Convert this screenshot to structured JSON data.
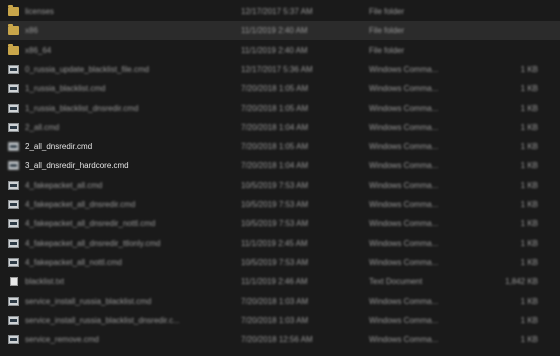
{
  "rows": [
    {
      "name": "licenses",
      "date": "12/17/2017 5:37 AM",
      "type": "File folder",
      "size": "",
      "icon": "folder"
    },
    {
      "name": "x86",
      "date": "11/1/2019 2:40 AM",
      "type": "File folder",
      "size": "",
      "icon": "folder",
      "selected": true
    },
    {
      "name": "x86_64",
      "date": "11/1/2019 2:40 AM",
      "type": "File folder",
      "size": "",
      "icon": "folder"
    },
    {
      "name": "0_russia_update_blacklist_file.cmd",
      "date": "12/17/2017 5:36 AM",
      "type": "Windows Comma...",
      "size": "1 KB",
      "icon": "cmd"
    },
    {
      "name": "1_russia_blacklist.cmd",
      "date": "7/20/2018 1:05 AM",
      "type": "Windows Comma...",
      "size": "1 KB",
      "icon": "cmd"
    },
    {
      "name": "1_russia_blacklist_dnsredir.cmd",
      "date": "7/20/2018 1:05 AM",
      "type": "Windows Comma...",
      "size": "1 KB",
      "icon": "cmd"
    },
    {
      "name": "2_all.cmd",
      "date": "7/20/2018 1:04 AM",
      "type": "Windows Comma...",
      "size": "1 KB",
      "icon": "cmd"
    },
    {
      "name": "2_all_dnsredir.cmd",
      "date": "7/20/2018 1:05 AM",
      "type": "Windows Comma...",
      "size": "1 KB",
      "icon": "cmd",
      "focus": true
    },
    {
      "name": "3_all_dnsredir_hardcore.cmd",
      "date": "7/20/2018 1:04 AM",
      "type": "Windows Comma...",
      "size": "1 KB",
      "icon": "cmd",
      "focus": true
    },
    {
      "name": "4_fakepacket_all.cmd",
      "date": "10/5/2019 7:53 AM",
      "type": "Windows Comma...",
      "size": "1 KB",
      "icon": "cmd"
    },
    {
      "name": "4_fakepacket_all_dnsredir.cmd",
      "date": "10/5/2019 7:53 AM",
      "type": "Windows Comma...",
      "size": "1 KB",
      "icon": "cmd"
    },
    {
      "name": "4_fakepacket_all_dnsredir_nottl.cmd",
      "date": "10/5/2019 7:53 AM",
      "type": "Windows Comma...",
      "size": "1 KB",
      "icon": "cmd"
    },
    {
      "name": "4_fakepacket_all_dnsredir_ttlonly.cmd",
      "date": "11/1/2019 2:45 AM",
      "type": "Windows Comma...",
      "size": "1 KB",
      "icon": "cmd"
    },
    {
      "name": "4_fakepacket_all_nottl.cmd",
      "date": "10/5/2019 7:53 AM",
      "type": "Windows Comma...",
      "size": "1 KB",
      "icon": "cmd"
    },
    {
      "name": "blacklist.txt",
      "date": "11/1/2019 2:46 AM",
      "type": "Text Document",
      "size": "1,842 KB",
      "icon": "txt"
    },
    {
      "name": "service_install_russia_blacklist.cmd",
      "date": "7/20/2018 1:03 AM",
      "type": "Windows Comma...",
      "size": "1 KB",
      "icon": "cmd"
    },
    {
      "name": "service_install_russia_blacklist_dnsredir.c...",
      "date": "7/20/2018 1:03 AM",
      "type": "Windows Comma...",
      "size": "1 KB",
      "icon": "cmd"
    },
    {
      "name": "service_remove.cmd",
      "date": "7/20/2018 12:56 AM",
      "type": "Windows Comma...",
      "size": "1 KB",
      "icon": "cmd"
    }
  ]
}
